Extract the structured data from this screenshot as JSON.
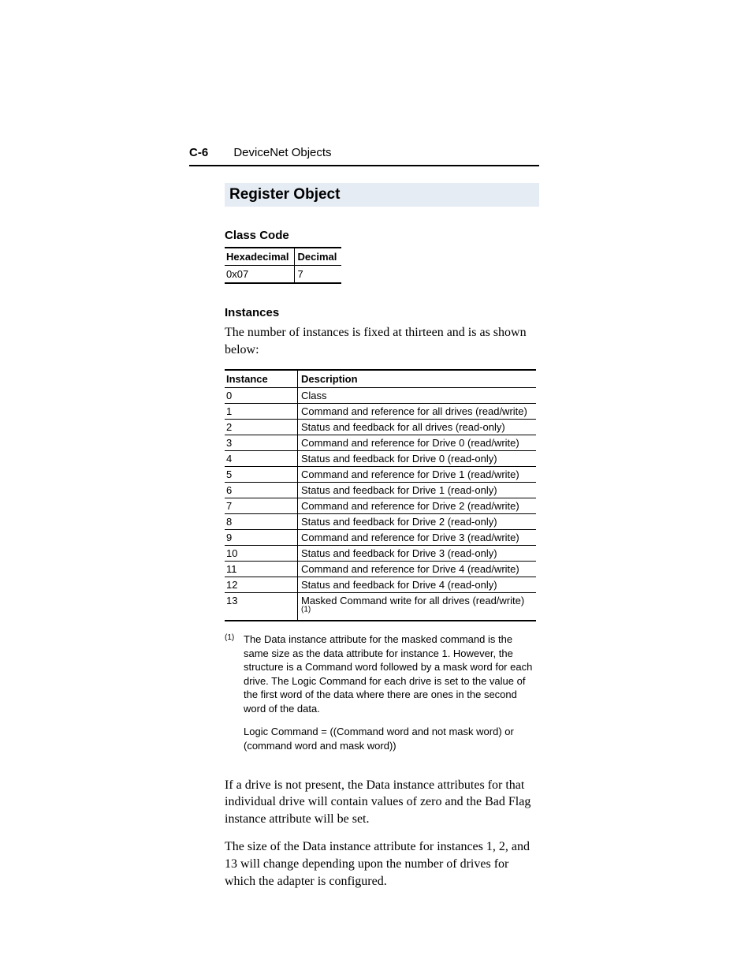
{
  "header": {
    "page_number": "C-6",
    "section_title": "DeviceNet Objects"
  },
  "title": "Register Object",
  "class_code": {
    "heading": "Class Code",
    "columns": [
      "Hexadecimal",
      "Decimal"
    ],
    "row": [
      "0x07",
      "7"
    ]
  },
  "instances": {
    "heading": "Instances",
    "intro": "The number of instances is fixed at thirteen and is as shown below:",
    "columns": [
      "Instance",
      "Description"
    ],
    "rows": [
      {
        "inst": "0",
        "desc": "Class"
      },
      {
        "inst": "1",
        "desc": "Command and reference for all drives (read/write)"
      },
      {
        "inst": "2",
        "desc": "Status and feedback for all drives (read-only)"
      },
      {
        "inst": "3",
        "desc": "Command and reference for Drive 0 (read/write)"
      },
      {
        "inst": "4",
        "desc": "Status and feedback for Drive 0 (read-only)"
      },
      {
        "inst": "5",
        "desc": "Command and reference for Drive 1 (read/write)"
      },
      {
        "inst": "6",
        "desc": "Status and feedback for Drive 1 (read-only)"
      },
      {
        "inst": "7",
        "desc": "Command and reference for Drive 2 (read/write)"
      },
      {
        "inst": "8",
        "desc": "Status and feedback for Drive 2 (read-only)"
      },
      {
        "inst": "9",
        "desc": "Command and reference for Drive 3 (read/write)"
      },
      {
        "inst": "10",
        "desc": "Status and feedback for Drive 3 (read-only)"
      },
      {
        "inst": "11",
        "desc": "Command and reference for Drive 4 (read/write)"
      },
      {
        "inst": "12",
        "desc": "Status and feedback for Drive 4 (read-only)"
      },
      {
        "inst": "13",
        "desc": "Masked Command write for all drives (read/write)",
        "sup": "(1)"
      }
    ]
  },
  "footnote": {
    "marker": "(1)",
    "para1": "The Data instance attribute for the masked command is the same size as the data attribute for instance 1. However, the structure is a Command word followed by a mask word for each drive. The Logic Command for each drive is set to the value of the first word of the data where there are ones in the second word of the data.",
    "para2": "Logic Command = ((Command word and not mask word) or (command word and mask word))"
  },
  "body_paras": {
    "p1": "If a drive is not present, the Data instance attributes for that individual drive will contain values of zero and the Bad Flag instance attribute will be set.",
    "p2": "The size of the Data instance attribute for instances 1, 2, and 13 will change depending upon the number of drives for which the adapter is configured."
  }
}
